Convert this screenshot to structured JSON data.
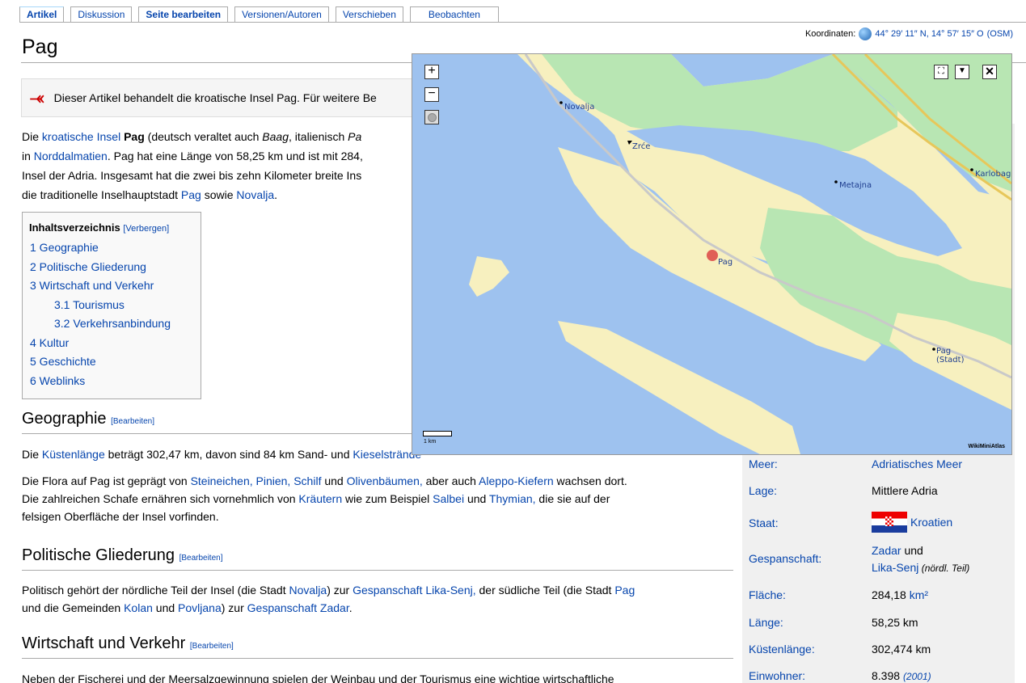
{
  "tabs": [
    "Artikel",
    "Diskussion",
    "Seite bearbeiten",
    "Versionen/Autoren",
    "Verschieben",
    "Beobachten"
  ],
  "title": "Pag",
  "coordinates": {
    "label": "Koordinaten:",
    "value": "44° 29′ 11″ N, 14° 57′ 15″ O",
    "osm": "(OSM)"
  },
  "hatnote": "Dieser Artikel behandelt die kroatische Insel Pag. Für weitere Be",
  "intro": {
    "l1_a": "Die ",
    "l1_link1": "kroatische Insel",
    "l1_b": " ",
    "l1_bold": "Pag",
    "l1_c": " (deutsch veraltet auch ",
    "l1_it1": "Baag",
    "l1_d": ", italienisch ",
    "l1_it2": "Pa",
    "l2_a": "in ",
    "l2_link": "Norddalmatien",
    "l2_b": ". Pag hat eine Länge von 58,25 km und ist mit 284,",
    "l3": "Insel der Adria. Insgesamt hat die zwei bis zehn Kilometer breite Ins",
    "l4_a": "die traditionelle Inselhauptstadt ",
    "l4_link1": "Pag",
    "l4_b": " sowie ",
    "l4_link2": "Novalja",
    "l4_c": "."
  },
  "toc": {
    "title": "Inhaltsverzeichnis",
    "toggle": "[Verbergen]",
    "items": [
      "1 Geographie",
      "2 Politische Gliederung",
      "3 Wirtschaft und Verkehr",
      "3.1 Tourismus",
      "3.2 Verkehrsanbindung",
      "4 Kultur",
      "5 Geschichte",
      "6 Weblinks"
    ]
  },
  "sections": {
    "edit": "[Bearbeiten]",
    "geo": "Geographie",
    "geo_p1_a": "Die ",
    "geo_p1_link": "Küstenlänge",
    "geo_p1_b": " beträgt 302,47 km, davon sind 84 km Sand- und ",
    "geo_p1_link2": "Kieselstrände",
    "geo_p2_a": "Die Flora auf Pag ist geprägt von ",
    "geo_p2_l1": "Steineichen,",
    "geo_p2_l2": "Pinien,",
    "geo_p2_l3": "Schilf",
    "geo_p2_b": " und ",
    "geo_p2_l4": "Olivenbäumen,",
    "geo_p2_c": " aber auch ",
    "geo_p2_l5": "Aleppo-Kiefern",
    "geo_p2_d": " wachsen dort.",
    "geo_p3_a": "Die zahlreichen Schafe ernähren sich vornehmlich von ",
    "geo_p3_l1": "Kräutern",
    "geo_p3_b": " wie zum Beispiel ",
    "geo_p3_l2": "Salbei",
    "geo_p3_c": " und ",
    "geo_p3_l3": "Thymian,",
    "geo_p3_d": " die sie auf der",
    "geo_p4": "felsigen Oberfläche der Insel vorfinden.",
    "pol": "Politische Gliederung",
    "pol_p1_a": "Politisch gehört der nördliche Teil der Insel (die Stadt ",
    "pol_p1_l1": "Novalja",
    "pol_p1_b": ") zur ",
    "pol_p1_l2": "Gespanschaft Lika-Senj,",
    "pol_p1_c": " der südliche Teil (die Stadt ",
    "pol_p1_l3": "Pag",
    "pol_p2_a": "und die Gemeinden ",
    "pol_p2_l1": "Kolan",
    "pol_p2_b": " und ",
    "pol_p2_l2": "Povljana",
    "pol_p2_c": ") zur ",
    "pol_p2_l3": "Gespanschaft Zadar",
    "pol_p2_d": ".",
    "wirt": "Wirtschaft und Verkehr",
    "wirt_p1": "Neben der Fischerei und der Meersalzgewinnung spielen der Weinbau und der Tourismus eine wichtige wirtschaftliche"
  },
  "map": {
    "places": [
      "Novalja",
      "Zrće",
      "Metajna",
      "Karlobag",
      "Pag",
      "Pag (Stadt)"
    ],
    "scale": "1 km",
    "credit": "WikiMiniAtlas"
  },
  "infobox": [
    {
      "label": "Meer:",
      "value": "Adriatisches Meer",
      "link": true
    },
    {
      "label": "Lage:",
      "value": "Mittlere Adria",
      "link": false
    },
    {
      "label": "Staat:",
      "value": "Kroatien",
      "link": true
    },
    {
      "label": "Gespanschaft:",
      "value": "Zadar",
      "value_b": " und",
      "value2": "Lika-Senj",
      "value2_note": " (nördl. Teil)"
    },
    {
      "label": "Fläche:",
      "value": "284,18 ",
      "unit": "km²"
    },
    {
      "label": "Länge:",
      "value": "58,25 km"
    },
    {
      "label": "Küstenlänge:",
      "value": "302,474 km"
    },
    {
      "label": "Einwohner:",
      "value": "8.398 ",
      "note": "(2001)"
    }
  ]
}
